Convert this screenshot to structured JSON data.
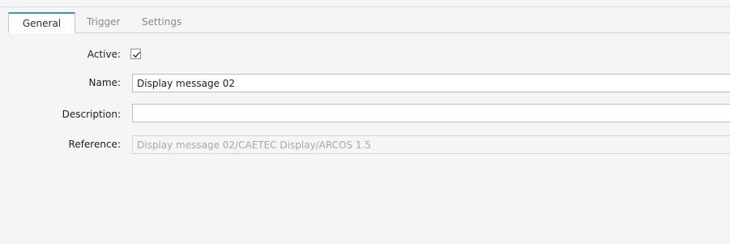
{
  "tabs": [
    {
      "label": "General",
      "active": true
    },
    {
      "label": "Trigger",
      "active": false
    },
    {
      "label": "Settings",
      "active": false
    }
  ],
  "form": {
    "active_label": "Active:",
    "active_checked": true,
    "name_label": "Name:",
    "name_value": "Display message 02",
    "description_label": "Description:",
    "description_value": "",
    "reference_label": "Reference:",
    "reference_value": "Display message 02/CAETEC Display/ARCOS 1.5"
  },
  "colors": {
    "active_tab_accent": "#3d8fd1",
    "background": "#f5f5f5"
  },
  "icons": {
    "checkbox_mark": "checkmark-icon"
  }
}
